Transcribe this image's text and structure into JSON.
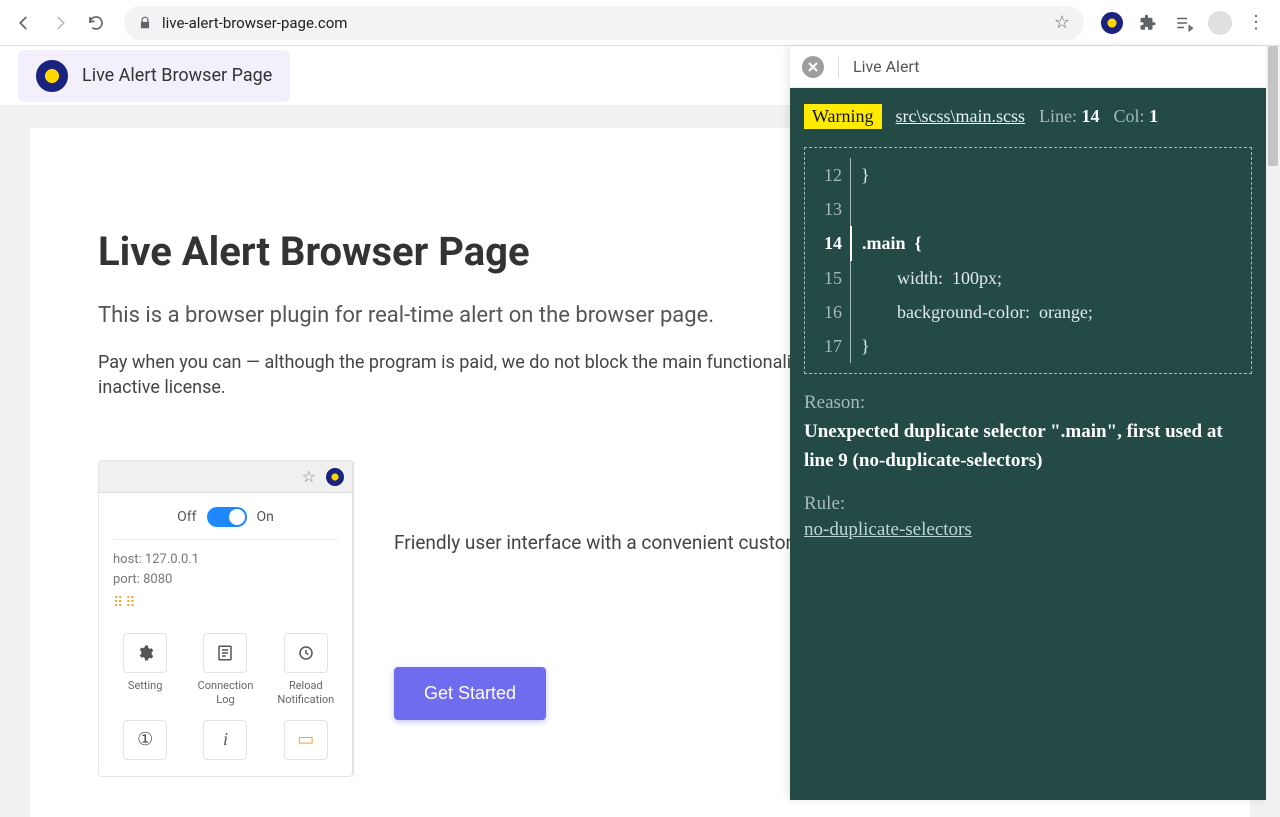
{
  "chrome": {
    "url": "live-alert-browser-page.com"
  },
  "tab": {
    "title": "Live Alert Browser Page"
  },
  "hero": {
    "title": "Live Alert Browser Page",
    "subtitle": "This is a browser plugin for real-time alert on the browser page.",
    "desc": "Pay when you can — although the program is paid, we do not block the main functionality of the program when using an inactive license."
  },
  "shot": {
    "off": "Off",
    "on": "On",
    "host_label": "host:",
    "host_value": "127.0.0.1",
    "port_label": "port:",
    "port_value": "8080",
    "actions": {
      "setting": "Setting",
      "conn": "Connection\nLog",
      "reload": "Reload\nNotification"
    }
  },
  "right_text": "Friendly user interface with a convenient customizable notification system of this plugin.",
  "cta": "Get Started",
  "panel": {
    "title": "Live Alert",
    "badge": "Warning",
    "file": "src\\scss\\main.scss",
    "line_label": "Line:",
    "line_value": "14",
    "col_label": "Col:",
    "col_value": "1",
    "code": [
      {
        "n": "12",
        "t": "}"
      },
      {
        "n": "13",
        "t": ""
      },
      {
        "n": "14",
        "t": ".main  {",
        "hl": true
      },
      {
        "n": "15",
        "t": "        width:  100px;"
      },
      {
        "n": "16",
        "t": "        background-color:  orange;"
      },
      {
        "n": "17",
        "t": "}"
      }
    ],
    "reason_label": "Reason:",
    "reason_text": "Unexpected duplicate selector \".main\", first used at line 9 (no-duplicate-selectors)",
    "rule_label": "Rule:",
    "rule_link": "no-duplicate-selectors"
  }
}
